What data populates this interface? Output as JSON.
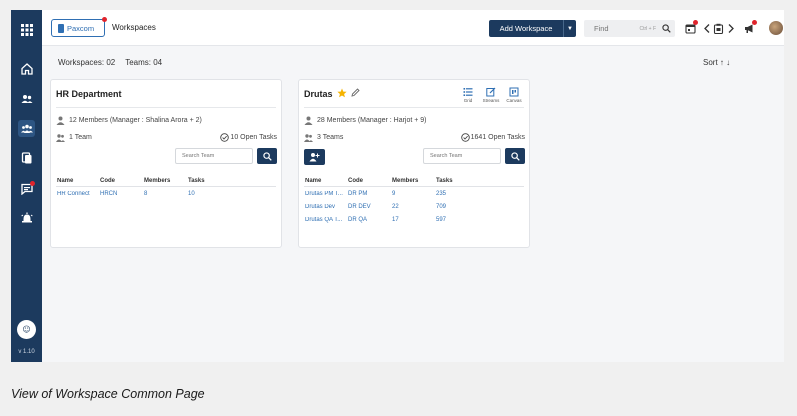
{
  "app": {
    "version": "v 1.10"
  },
  "topbar": {
    "org_label": "Paxcom",
    "breadcrumb": "Workspaces",
    "add_workspace_label": "Add Workspace",
    "find_placeholder": "Find",
    "find_shortcut": "Ctrl + F"
  },
  "summary": {
    "workspaces": "Workspaces: 02",
    "teams": "Teams: 04",
    "sort_label": "Sort ↑ ↓"
  },
  "workspaces": [
    {
      "name": "HR Department",
      "members": "12 Members  (Manager : Shalina Arora + 2)",
      "teams": "1 Team",
      "open_tasks": "10 Open Tasks",
      "search_placeholder": "Search Team",
      "columns": [
        "Name",
        "Code",
        "Members",
        "Tasks"
      ],
      "rows": [
        [
          "HR Connect",
          "HRCN",
          "8",
          "10"
        ]
      ]
    },
    {
      "name": "Drutas",
      "members": "28 Members  (Manager : Harjot + 9)",
      "teams": "3 Teams",
      "open_tasks": "1641 Open Tasks",
      "search_placeholder": "Search Team",
      "views": [
        "Grid",
        "Streams",
        "Canvas"
      ],
      "columns": [
        "Name",
        "Code",
        "Members",
        "Tasks"
      ],
      "rows": [
        [
          "Drutas PM T...",
          "DR PM",
          "9",
          "235"
        ],
        [
          "Drutas Dev",
          "DR DEV",
          "22",
          "709"
        ],
        [
          "Drutas QA T...",
          "DR QA",
          "17",
          "597"
        ]
      ]
    }
  ],
  "caption": "View of Workspace Common Page",
  "colors": {
    "navy": "#1c3a5e",
    "link": "#2f6fb3",
    "alert": "#e0242c",
    "star": "#f5b301"
  }
}
